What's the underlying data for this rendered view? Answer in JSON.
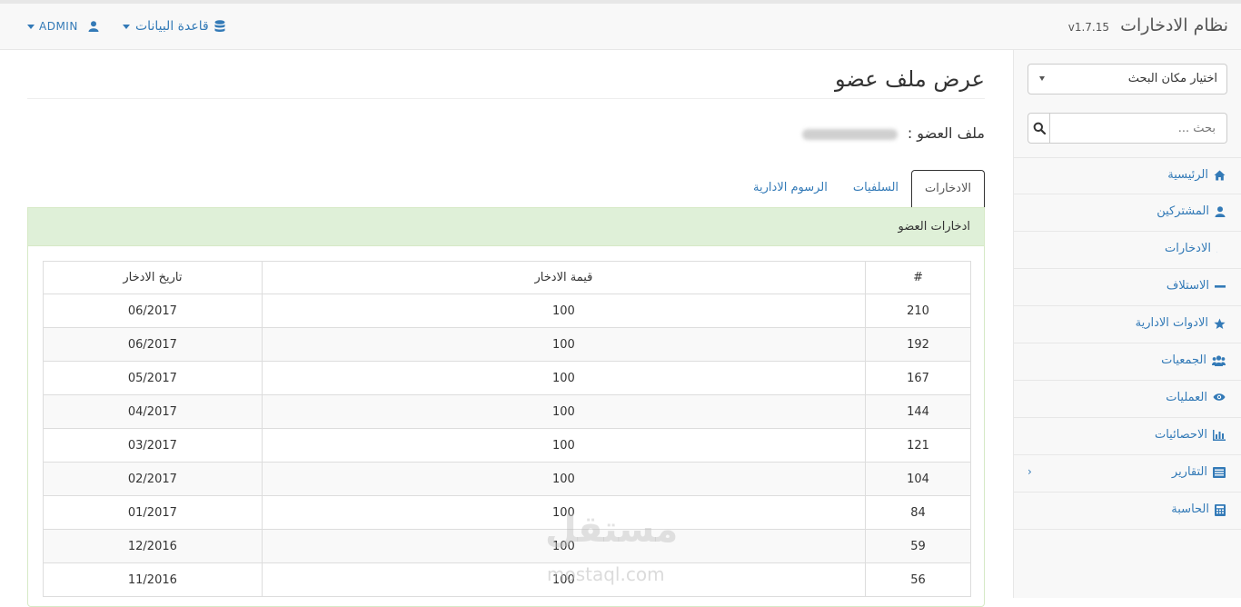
{
  "header": {
    "brand": "نظام الادخارات",
    "version": "v1.7.15",
    "db_menu": "قاعدة البيانات",
    "user_menu": "ADMIN"
  },
  "sidebar": {
    "select_label": "اختيار مكان البحث",
    "search_placeholder": "بحث ...",
    "items": [
      {
        "label": "الرئيسية",
        "icon": "home-icon"
      },
      {
        "label": "المشتركين",
        "icon": "user-icon"
      },
      {
        "label": "الادخارات",
        "icon": "dollar-icon"
      },
      {
        "label": "الاستلاف",
        "icon": "minus-icon"
      },
      {
        "label": "الادوات الادارية",
        "icon": "star-icon"
      },
      {
        "label": "الجمعيات",
        "icon": "users-icon"
      },
      {
        "label": "العمليات",
        "icon": "eye-icon"
      },
      {
        "label": "الاحصائيات",
        "icon": "bar-chart-icon"
      },
      {
        "label": "التقارير",
        "icon": "list-icon"
      },
      {
        "label": "الحاسبة",
        "icon": "calculator-icon"
      }
    ]
  },
  "main": {
    "page_title": "عرض ملف عضو",
    "member_label": "ملف العضو :",
    "tabs": [
      {
        "label": "الادخارات",
        "active": true
      },
      {
        "label": "السلفيات",
        "active": false
      },
      {
        "label": "الرسوم الادارية",
        "active": false
      }
    ],
    "panel_title": "ادخارات العضو",
    "table": {
      "columns": [
        "#",
        "قيمة الادخار",
        "تاريخ الادخار"
      ],
      "rows": [
        [
          "210",
          "100",
          "06/2017"
        ],
        [
          "192",
          "100",
          "06/2017"
        ],
        [
          "167",
          "100",
          "05/2017"
        ],
        [
          "144",
          "100",
          "04/2017"
        ],
        [
          "121",
          "100",
          "03/2017"
        ],
        [
          "104",
          "100",
          "02/2017"
        ],
        [
          "84",
          "100",
          "01/2017"
        ],
        [
          "59",
          "100",
          "12/2016"
        ],
        [
          "56",
          "100",
          "11/2016"
        ]
      ]
    }
  },
  "watermark": {
    "arabic": "مستقل",
    "latin": "mostaql.com"
  },
  "colors": {
    "link": "#337ab7",
    "panel_heading": "#dff0d8",
    "panel_border": "#d6e9c6"
  }
}
